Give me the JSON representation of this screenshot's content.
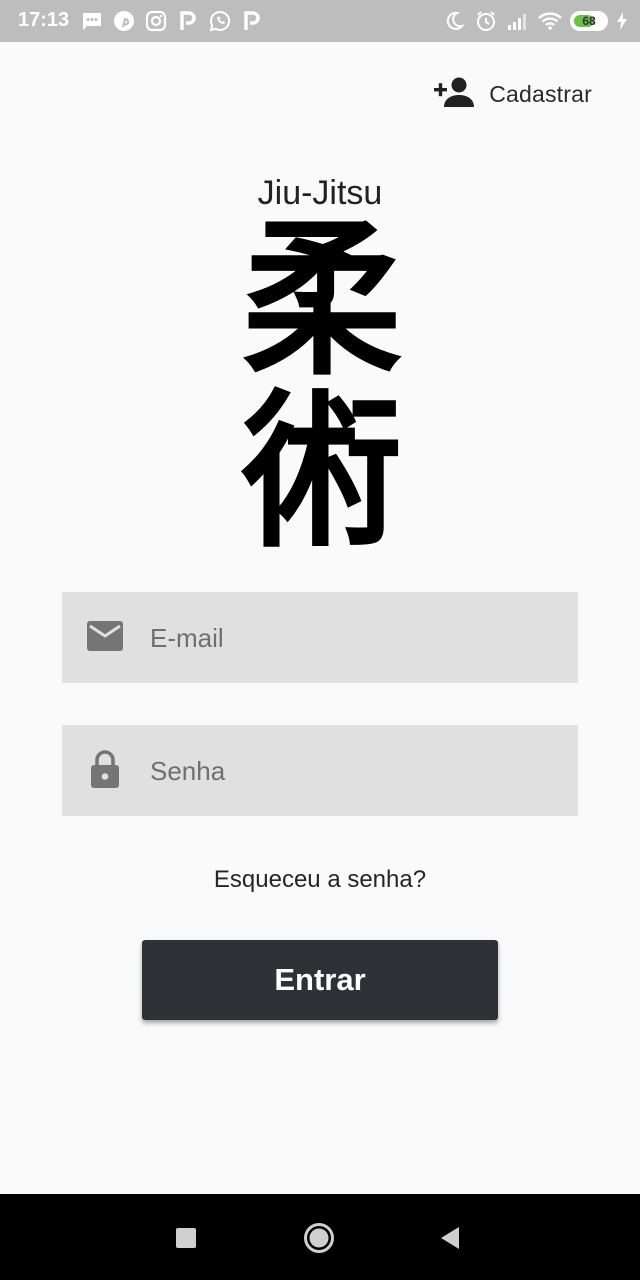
{
  "status_bar": {
    "time": "17:13",
    "battery_level": "68",
    "battery_fraction": 0.68,
    "left_icons": [
      "message-icon",
      "pinterest-icon",
      "instagram-icon",
      "p-app-icon",
      "whatsapp-icon",
      "p-app-icon"
    ],
    "right_icons": [
      "moon-icon",
      "alarm-icon",
      "signal-icon",
      "wifi-icon",
      "battery-icon",
      "charging-icon"
    ]
  },
  "header": {
    "signup_label": "Cadastrar",
    "signup_icon": "person-add-icon"
  },
  "app": {
    "title": "Jiu-Jitsu",
    "logo_kanji_1": "柔",
    "logo_kanji_2": "術"
  },
  "form": {
    "email_placeholder": "E-mail",
    "email_icon": "email-icon",
    "password_placeholder": "Senha",
    "password_icon": "lock-icon",
    "forgot_label": "Esqueceu a senha?",
    "submit_label": "Entrar"
  },
  "nav_bar": {
    "buttons": [
      "recents-button",
      "home-button",
      "back-button"
    ]
  },
  "colors": {
    "background": "#fafafa",
    "status_bar": "#bdbdbd",
    "field_background": "#e0e0e0",
    "button_background": "#2e3236",
    "battery_green": "#6cc04a"
  }
}
